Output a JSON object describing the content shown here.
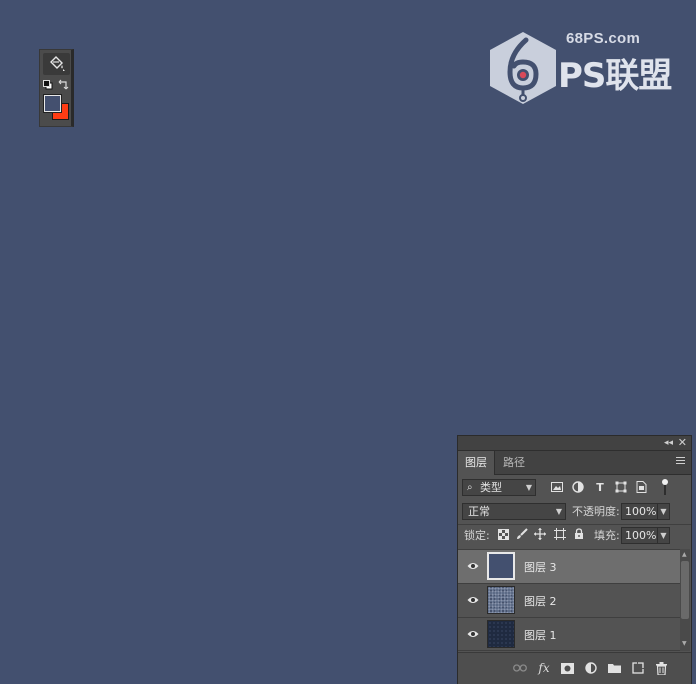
{
  "colors": {
    "canvas": "#43506f",
    "foreground_swatch": "#44506f",
    "background_swatch": "#ff3c14",
    "layer3_fill": "#43506f",
    "layer2_fill": "#5c6b86",
    "layer1_fill": "#1f2a40"
  },
  "watermark": {
    "site": "68PS.com",
    "brand": "PS联盟"
  },
  "toolbar": {
    "active_tool_icon": "paint-bucket-icon",
    "default_colors_icon": "default-colors-icon",
    "swap_icon": "swap-colors-icon"
  },
  "layers_panel": {
    "tabs": [
      {
        "label": "图层",
        "active": true
      },
      {
        "label": "路径",
        "active": false
      }
    ],
    "filter": {
      "selected": "类型",
      "icons": [
        "image-filter-icon",
        "adjustment-filter-icon",
        "type-filter-icon",
        "shape-filter-icon",
        "smart-object-filter-icon"
      ]
    },
    "blend_mode": "正常",
    "opacity_label": "不透明度:",
    "opacity_value": "100%",
    "lock_label": "锁定:",
    "fill_label": "填充:",
    "fill_value": "100%",
    "layers": [
      {
        "name": "图层 3",
        "visible": true,
        "selected": true
      },
      {
        "name": "图层 2",
        "visible": true,
        "selected": false
      },
      {
        "name": "图层 1",
        "visible": true,
        "selected": false
      }
    ],
    "footer_icons": [
      "link-layers-icon",
      "fx-icon",
      "add-mask-icon",
      "new-adjustment-icon",
      "new-group-icon",
      "new-layer-icon",
      "delete-icon"
    ]
  }
}
